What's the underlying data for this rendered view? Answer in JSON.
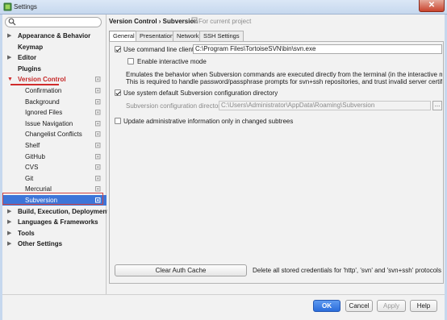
{
  "window": {
    "title": "Settings",
    "close_label": "✕",
    "colors": {
      "selection": "#3d75d8",
      "primary_button": "#2b6ddb",
      "annotation_red": "#d02c2c"
    }
  },
  "search": {
    "placeholder": "",
    "icon": "search-icon"
  },
  "tree": [
    {
      "label": "Appearance & Behavior",
      "bold": true,
      "arrow": "▶",
      "indent": 0
    },
    {
      "label": "Keymap",
      "bold": true,
      "arrow": "",
      "indent": 0
    },
    {
      "label": "Editor",
      "bold": true,
      "arrow": "▶",
      "indent": 0
    },
    {
      "label": "Plugins",
      "bold": true,
      "arrow": "",
      "indent": 0
    },
    {
      "label": "Version Control",
      "bold": true,
      "arrow": "▼",
      "indent": 0,
      "project": true
    },
    {
      "label": "Confirmation",
      "bold": false,
      "arrow": "",
      "indent": 1,
      "project": true
    },
    {
      "label": "Background",
      "bold": false,
      "arrow": "",
      "indent": 1,
      "project": true
    },
    {
      "label": "Ignored Files",
      "bold": false,
      "arrow": "",
      "indent": 1,
      "project": true
    },
    {
      "label": "Issue Navigation",
      "bold": false,
      "arrow": "",
      "indent": 1,
      "project": true
    },
    {
      "label": "Changelist Conflicts",
      "bold": false,
      "arrow": "",
      "indent": 1,
      "project": true
    },
    {
      "label": "Shelf",
      "bold": false,
      "arrow": "",
      "indent": 1,
      "project": true
    },
    {
      "label": "GitHub",
      "bold": false,
      "arrow": "",
      "indent": 1,
      "project": true
    },
    {
      "label": "CVS",
      "bold": false,
      "arrow": "",
      "indent": 1,
      "project": true
    },
    {
      "label": "Git",
      "bold": false,
      "arrow": "",
      "indent": 1,
      "project": true
    },
    {
      "label": "Mercurial",
      "bold": false,
      "arrow": "",
      "indent": 1,
      "project": true
    },
    {
      "label": "Subversion",
      "bold": false,
      "arrow": "",
      "indent": 1,
      "project": true,
      "selected": true
    },
    {
      "label": "Build, Execution, Deployment",
      "bold": true,
      "arrow": "▶",
      "indent": 0
    },
    {
      "label": "Languages & Frameworks",
      "bold": true,
      "arrow": "▶",
      "indent": 0
    },
    {
      "label": "Tools",
      "bold": true,
      "arrow": "▶",
      "indent": 0
    },
    {
      "label": "Other Settings",
      "bold": true,
      "arrow": "▶",
      "indent": 0
    }
  ],
  "breadcrumb": {
    "path": "Version Control › Subversion",
    "note": "For current project"
  },
  "tabs": [
    {
      "label": "General",
      "active": true
    },
    {
      "label": "Presentation",
      "active": false
    },
    {
      "label": "Network",
      "active": false
    },
    {
      "label": "SSH Settings",
      "active": false
    }
  ],
  "general": {
    "use_cli_label": "Use command line client:",
    "use_cli_checked": true,
    "cli_path": "C:\\Program Files\\TortoiseSVN\\bin\\svn.exe",
    "interactive_label": "Enable interactive mode",
    "interactive_checked": false,
    "interactive_desc_1": "Emulates the behavior when Subversion commands are executed directly from the terminal (in the interactive mode).",
    "interactive_desc_2": "This is required to handle password/passphrase prompts for svn+ssh repositories, and trust invalid server certificates for ht",
    "use_default_dir_label": "Use system default Subversion configuration directory",
    "use_default_dir_checked": true,
    "config_dir_label": "Subversion configuration directory:",
    "config_dir_value": "C:\\Users\\Administrator\\AppData\\Roaming\\Subversion",
    "update_label": "Update administrative information only in changed subtrees",
    "update_checked": false,
    "clear_cache_label": "Clear Auth Cache",
    "clear_cache_desc": "Delete all stored credentials for 'http', 'svn' and 'svn+ssh' protocols"
  },
  "buttons": {
    "ok": "OK",
    "cancel": "Cancel",
    "apply": "Apply",
    "help": "Help"
  }
}
